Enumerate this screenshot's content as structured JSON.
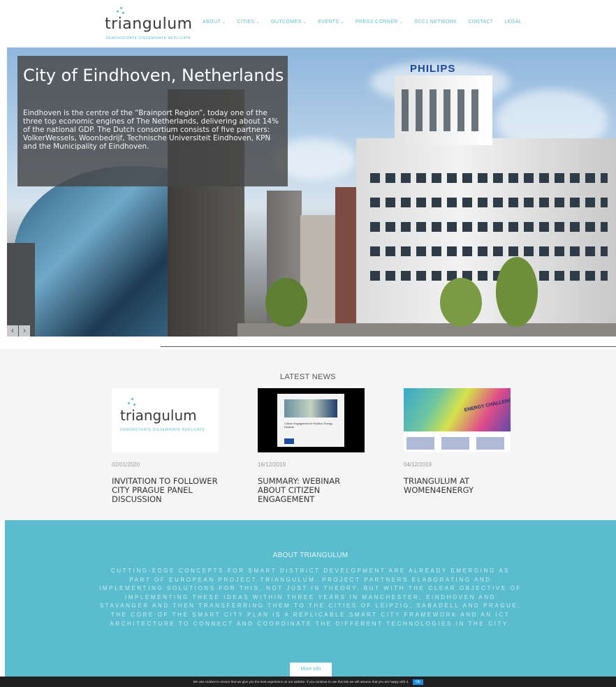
{
  "header": {
    "logo_word": "triangulum",
    "logo_tagline": "DEMONSTRATE DISSEMINATE REPLICATE",
    "nav": [
      {
        "label": "ABOUT",
        "dropdown": true
      },
      {
        "label": "CITIES",
        "dropdown": true
      },
      {
        "label": "OUTCOMES",
        "dropdown": true
      },
      {
        "label": "EVENTS",
        "dropdown": true
      },
      {
        "label": "PRESS CORNER",
        "dropdown": true
      },
      {
        "label": "SCC1 NETWORK",
        "dropdown": false
      },
      {
        "label": "CONTACT",
        "dropdown": false
      },
      {
        "label": "LEGAL",
        "dropdown": false
      }
    ],
    "caret": "⌄"
  },
  "hero": {
    "title": "City of Eindhoven, Netherlands",
    "text": "Eindhoven is the centre of the “Brainport Region”, today one of the three top economic engines of The Netherlands, delivering about 14% of the national GDP. The Dutch consortium consists of five partners: VolkerWessels, Woonbedrijf, Technische Universiteit Eindhoven, KPN and the Municipality of Eindhoven.",
    "sign_text": "PHILIPS",
    "prev_label": "‹",
    "next_label": "›"
  },
  "news": {
    "heading": "LATEST NEWS",
    "cards": [
      {
        "date": "02/01/2020",
        "title": "INVITATION TO FOLLOWER CITY PRAGUE PANEL DISCUSSION",
        "thumb_word": "triangulum",
        "thumb_tag": "DEMONSTRATE DISSEMINATE REPLICATE"
      },
      {
        "date": "16/12/2019",
        "title": "SUMMARY: WEBINAR ABOUT CITIZEN ENGAGEMENT",
        "thumb_caption": "Citizen Engagement in Positive Energy Districts"
      },
      {
        "date": "04/12/2019",
        "title": "TRIANGULUM AT WOMEN4ENERGY",
        "thumb_caption": "ENERGY CHALLENGES!"
      }
    ]
  },
  "about": {
    "heading": "ABOUT TRIANGULUM",
    "text": "Cutting-edge concepts for smart district development are already emerging as part of European project Triangulum. Project partners elaborating and implementing solutions for this, not just in theory, but with the clear objective of implementing these ideas within three years in Manchester, Eindhoven and Stavanger and then transferring them to the cities of Leipzig, Sabadell and Prague. The core of the smart city plan is a replicable smart city framework and an ICT architecture to connect and coordinate the different technologies in the city.",
    "button": "More info"
  },
  "cookie": {
    "text": "We use cookies to ensure that we give you the best experience on our website. If you continue to use this site we will assume that you are happy with it.",
    "ok": "Ok"
  },
  "colors": {
    "accent": "#5bbccd",
    "cookie_bg": "#202020",
    "cookie_button": "#1f8ae0"
  }
}
